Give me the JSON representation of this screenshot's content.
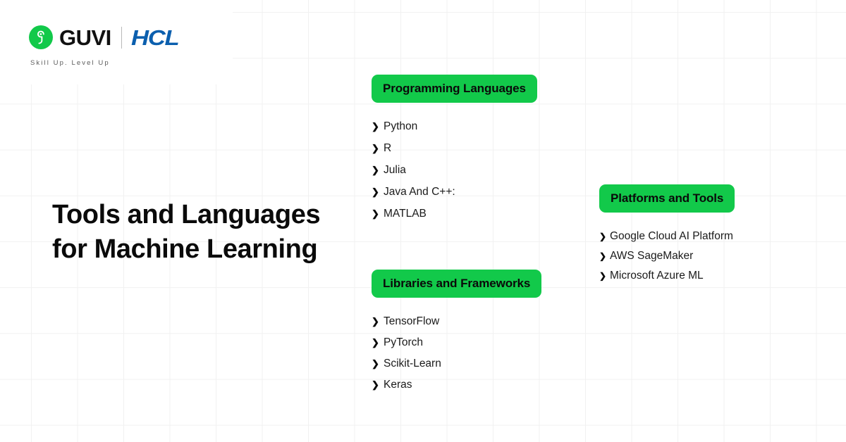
{
  "brand": {
    "logo_mark_name": "guvi-g-icon",
    "wordmark": "GUVI",
    "partner_wordmark": "HCL",
    "tagline": "Skill Up. Level Up",
    "green": "#12C94A",
    "blue": "#0B5FAE"
  },
  "headline": {
    "title": "Tools and Languages for Machine Learning"
  },
  "categories": [
    {
      "badge": "Programming Languages",
      "items": [
        "Python",
        "R",
        "Julia",
        "Java And C++:",
        "MATLAB"
      ]
    },
    {
      "badge": "Libraries and Frameworks",
      "items": [
        "TensorFlow",
        "PyTorch",
        "Scikit-Learn",
        "Keras"
      ]
    },
    {
      "badge": "Platforms and Tools",
      "items": [
        "Google Cloud AI Platform",
        "AWS SageMaker",
        "Microsoft Azure ML"
      ]
    }
  ],
  "bullet_glyph": "❯"
}
